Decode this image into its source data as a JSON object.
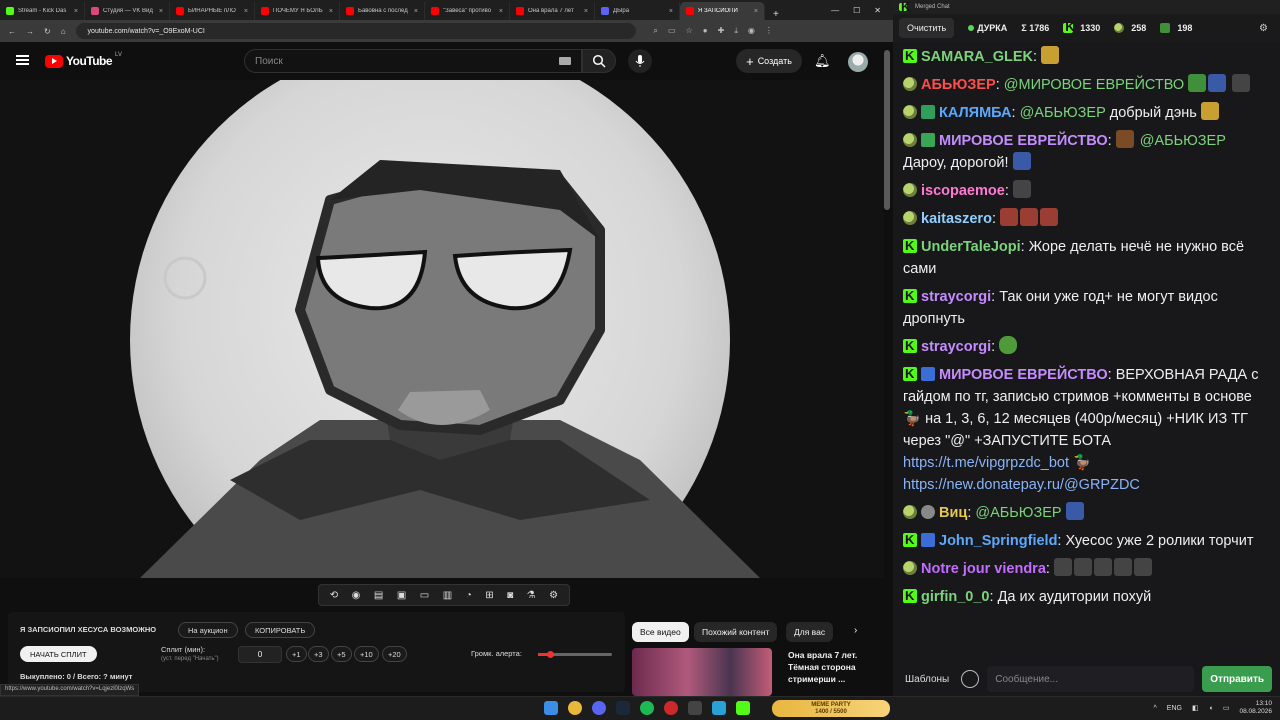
{
  "browser": {
    "tabs": [
      {
        "label": "Stream - Kick Das",
        "color": "#53fc18"
      },
      {
        "label": "Студия — VK Вид",
        "color": "#e0457b"
      },
      {
        "label": "БИНАРНЫЕ пЛО",
        "color": "#ff0000"
      },
      {
        "label": "ПОЧЕМУ Я БОЛЬ",
        "color": "#ff0000"
      },
      {
        "label": "Бавовна с послед",
        "color": "#ff0000"
      },
      {
        "label": "\"Завеса\" противо",
        "color": "#ff0000"
      },
      {
        "label": "Она врала 7 лет",
        "color": "#ff0000"
      },
      {
        "label": "ДЫра",
        "color": "#5865f2"
      },
      {
        "label": "Я ЗАПСИОПИ",
        "color": "#ff0000"
      }
    ],
    "new_tab": "+",
    "url": "youtube.com/watch?v=_O9ExoM-UCI",
    "status_url": "https://www.youtube.com/watch?v=Lqjezl0lzqWs"
  },
  "youtube": {
    "logo_text": "YouTube",
    "region": "LV",
    "search_placeholder": "Поиск",
    "create_label": "Создать",
    "panel": {
      "title": "Я ЗАПСИОПИЛ ХЕСУСА ВОЗМОЖНО",
      "auction_label": "На аукцион",
      "copy_label": "КОПИРОВАТЬ",
      "start_split_label": "НАЧАТЬ СПЛИТ",
      "split_label": "Сплит (мин):",
      "split_hint": "(уст. перед \"Начать\")",
      "split_value": "0",
      "increments": [
        "+1",
        "+3",
        "+5",
        "+10",
        "+20"
      ],
      "volume_label": "Громк. алерта:",
      "volume_level": 0.16,
      "bought": "Выкуплено: 0 / Всего: ? минут"
    },
    "recs": {
      "tabs": [
        "Все видео",
        "Похожий контент",
        "Для вас"
      ],
      "video_title": "Она врала 7 лет. Тёмная сторона стримерши ..."
    }
  },
  "chat": {
    "window_title": "Merged Chat",
    "clear_label": "Очистить",
    "channel": "ДУРКА",
    "total": "Σ 1786",
    "kick_count": "1330",
    "twitch_count": "258",
    "other_count": "198",
    "messages": [
      {
        "nick": "SAMARA_GLEK",
        "color": "#7bd37b",
        "text": ""
      },
      {
        "nick": "АБЬЮЗЕР",
        "color": "#ff4d4d",
        "mention": "@МИРОВОЕ ЕВРЕЙСТВО",
        "text": ""
      },
      {
        "nick": "КАЛЯМБА",
        "color": "#5aa9ff",
        "mention": "@АБЬЮЗЕР",
        "text": "добрый дэнь"
      },
      {
        "nick": "МИРОВОЕ ЕВРЕЙСТВО",
        "color": "#c58cff",
        "mention": "@АБЬЮЗЕР",
        "text": "Дароу, дорогой!"
      },
      {
        "nick": "iscopaemoe",
        "color": "#ff7ad1",
        "text": ""
      },
      {
        "nick": "kaitaszero",
        "color": "#8fd0ff",
        "text": ""
      },
      {
        "nick": "UnderTaleJopi",
        "color": "#7bd37b",
        "text": "Жоре делать нечё не нужно всё сами"
      },
      {
        "nick": "straycorgi",
        "color": "#c58cff",
        "text": "Так они уже год+ не могут видос дропнуть"
      },
      {
        "nick": "straycorgi",
        "color": "#c58cff",
        "text": ""
      },
      {
        "nick": "МИРОВОЕ ЕВРЕЙСТВО",
        "color": "#c58cff",
        "text": "ВЕРХОВНАЯ РАДА с гайдом по тг, записью стримов +комменты в основе 🦆 на 1, 3, 6, 12 месяцев (400р/месяц) +НИК ИЗ ТГ через \"@\" +ЗАПУСТИТЕ БОТА",
        "link1": "https://t.me/vipgrpzdc_bot",
        "link2": "https://new.donatepay.ru/@GRPZDC"
      },
      {
        "nick": "Виц",
        "color": "#e6c84d",
        "mention": "@АБЬЮЗЕР",
        "text": ""
      },
      {
        "nick": "John_Springfield",
        "color": "#5aa9ff",
        "text": "Хуесос уже 2 ролики торчит"
      },
      {
        "nick": "Notre jour viendra",
        "color": "#c36cff",
        "text": ""
      },
      {
        "nick": "girfin_0_0",
        "color": "#7bd37b",
        "text": "Да их аудитории похуй"
      }
    ],
    "templates_label": "Шаблоны",
    "input_placeholder": "Сообщение...",
    "send_label": "Отправить"
  },
  "taskbar": {
    "meme_party": "MEME PARTY",
    "meme_progress": "1400 / 5500",
    "lang": "ENG",
    "time": "13:10",
    "date": "08.08.2026"
  }
}
